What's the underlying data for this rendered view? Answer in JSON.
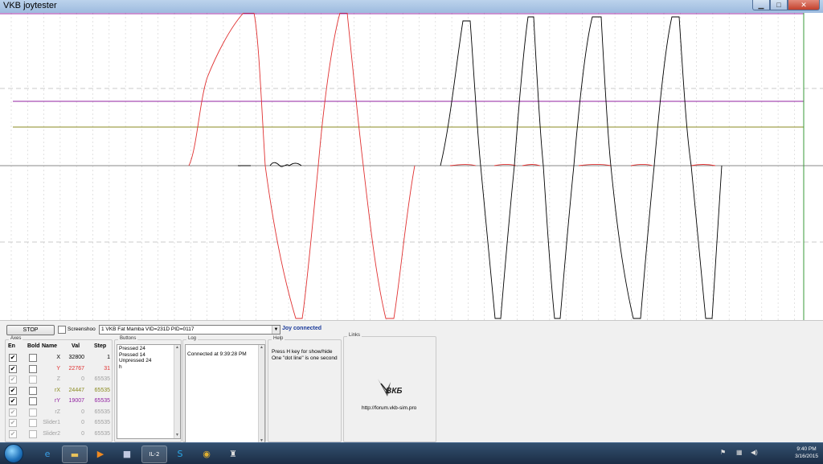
{
  "window": {
    "title": "VKB joytester"
  },
  "controls": {
    "stop_label": "STOP",
    "screenshot_label": "Screenshoo",
    "device_value": "1 VKB Fat Mamba   VID=231D PID=0117",
    "status_label": "Joy connected"
  },
  "axes": {
    "group_label": "Axes",
    "headers": {
      "en": "En",
      "bold": "Bold",
      "name": "Name",
      "val": "Val",
      "step": "Step"
    },
    "rows": [
      {
        "name": "X",
        "val": "32800",
        "step": "1",
        "enabled": true,
        "color": "#000000"
      },
      {
        "name": "Y",
        "val": "22767",
        "step": "31",
        "enabled": true,
        "color": "#e03030"
      },
      {
        "name": "Z",
        "val": "0",
        "step": "65535",
        "enabled": false,
        "color": "#a0a0a0"
      },
      {
        "name": "rX",
        "val": "24447",
        "step": "65535",
        "enabled": true,
        "color": "#8a8a20"
      },
      {
        "name": "rY",
        "val": "19007",
        "step": "65535",
        "enabled": true,
        "color": "#9020a0"
      },
      {
        "name": "rZ",
        "val": "0",
        "step": "65535",
        "enabled": false,
        "color": "#a0a0a0"
      },
      {
        "name": "Slider1",
        "val": "0",
        "step": "65535",
        "enabled": false,
        "color": "#a0a0a0"
      },
      {
        "name": "Slider2",
        "val": "0",
        "step": "65535",
        "enabled": false,
        "color": "#a0a0a0"
      }
    ]
  },
  "buttons_group": {
    "label": "Buttons",
    "lines": [
      "Pressed 24",
      "Pressed 14",
      "Unpressed 24",
      "h"
    ]
  },
  "log_group": {
    "label": "Log",
    "lines": [
      "Connected at 9:39:28 PM"
    ]
  },
  "help_group": {
    "label": "Help",
    "lines": [
      "Press H key for show/hide",
      "One \"dot line\" is one second"
    ]
  },
  "links_group": {
    "label": "Links",
    "logo_text": "ВКБ",
    "url": "http://forum.vkb-sim.pro"
  },
  "taskbar": {
    "apps": [
      {
        "name": "ie-icon",
        "glyph": "e",
        "color": "#3aa0e8"
      },
      {
        "name": "folder-icon",
        "glyph": "▬",
        "color": "#e8c25a"
      },
      {
        "name": "media-player-icon",
        "glyph": "▶",
        "color": "#f08a20"
      },
      {
        "name": "floppy-icon",
        "glyph": "■",
        "color": "#c0c8e0"
      },
      {
        "name": "il2-icon",
        "glyph": "IL-2",
        "color": "#ffffff"
      },
      {
        "name": "skype-icon",
        "glyph": "S",
        "color": "#2aa8e8"
      },
      {
        "name": "chrome-icon",
        "glyph": "◉",
        "color": "#e0b030"
      },
      {
        "name": "joystick-icon",
        "glyph": "♜",
        "color": "#dddddd"
      }
    ],
    "time": "9:40 PM",
    "date": "3/16/2015"
  },
  "chart_data": {
    "type": "line",
    "title": "",
    "series": [
      {
        "color": "#e03030",
        "label": "Y"
      },
      {
        "color": "#000000",
        "label": "X"
      },
      {
        "color": "#9020a0",
        "label": "rY"
      },
      {
        "color": "#8a8a20",
        "label": "rX"
      }
    ]
  }
}
